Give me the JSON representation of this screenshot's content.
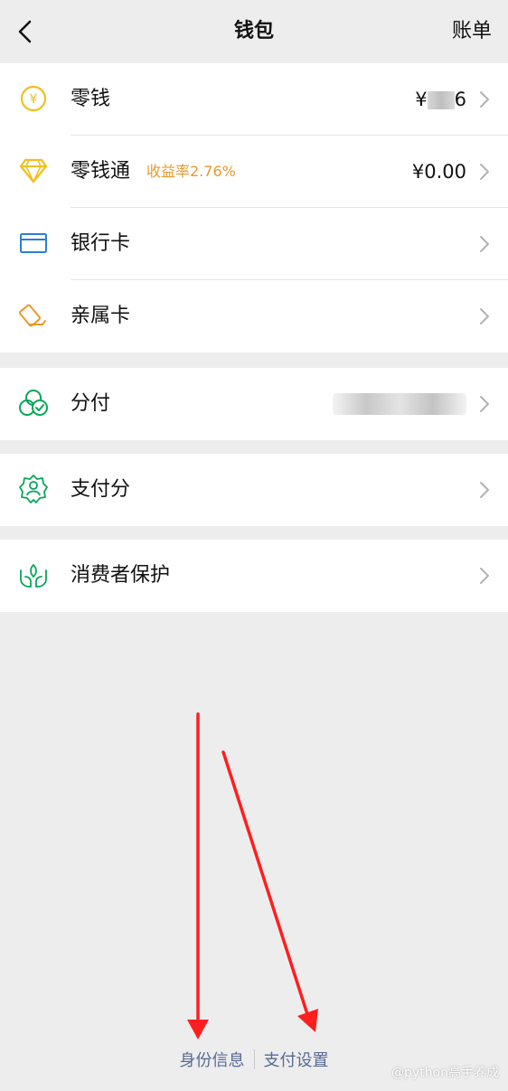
{
  "header": {
    "title": "钱包",
    "bill_label": "账单"
  },
  "groups": {
    "wallet": {
      "change": {
        "label": "零钱",
        "value_prefix": "¥",
        "value_suffix": "6"
      },
      "lqt": {
        "label": "零钱通",
        "badge": "收益率2.76%",
        "value": "¥0.00"
      },
      "bank_card": {
        "label": "银行卡"
      },
      "family_card": {
        "label": "亲属卡"
      }
    },
    "fenfu": {
      "label": "分付"
    },
    "score": {
      "label": "支付分"
    },
    "protection": {
      "label": "消费者保护"
    }
  },
  "bottom": {
    "identity_label": "身份信息",
    "settings_label": "支付设置"
  },
  "watermark": "@python高手养成",
  "colors": {
    "page_bg": "#ededed",
    "row_bg": "#ffffff",
    "gold": "#f0c020",
    "green": "#07a65a",
    "blue": "#2a7fd4",
    "orange": "#e89a2c",
    "link": "#576b95",
    "arrow_red": "#ff1e1e"
  },
  "icons": {
    "back": "chevron-left-icon",
    "change": "yuan-coin-icon",
    "lqt": "diamond-icon",
    "bank_card": "bank-card-icon",
    "family_card": "family-card-icon",
    "fenfu": "three-circles-check-icon",
    "score": "badge-person-icon",
    "protection": "hands-leaf-icon",
    "chevron": "chevron-right-icon"
  }
}
